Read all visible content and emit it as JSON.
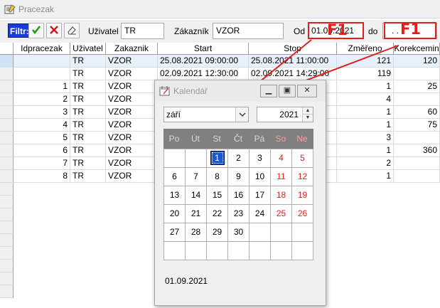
{
  "window": {
    "title": "Pracezak",
    "icon": "notebook-icon"
  },
  "filter": {
    "label": "Filtr:",
    "apply_icon": "checkmark-icon",
    "clear_icon": "x-icon",
    "erase_icon": "eraser-icon",
    "user_label": "Uživatel",
    "user_value": "TR",
    "customer_label": "Zákazník",
    "customer_value": "VZOR",
    "from_label": "Od",
    "from_value": "01.09.2021",
    "to_label": "do",
    "to_value": ". .",
    "annotation_from": "F1",
    "annotation_to": "F1"
  },
  "table": {
    "columns": [
      "Idpracezak",
      "Uživatel",
      "Zakaznik",
      "Start",
      "Stop",
      "Změřeno",
      "Korekcemin"
    ],
    "rows": [
      {
        "id": "",
        "user": "TR",
        "customer": "VZOR",
        "start": "25.08.2021 09:00:00",
        "stop": "25.08.2021 11:00:00",
        "measured": "121",
        "correction": "120"
      },
      {
        "id": "",
        "user": "TR",
        "customer": "VZOR",
        "start": "02.09.2021 12:30:00",
        "stop": "02.09.2021 14:29:00",
        "measured": "119",
        "correction": ""
      },
      {
        "id": "1",
        "user": "TR",
        "customer": "VZOR",
        "start": "",
        "stop": "3",
        "measured": "1",
        "correction": "25"
      },
      {
        "id": "2",
        "user": "TR",
        "customer": "VZOR",
        "start": "",
        "stop": "5",
        "measured": "4",
        "correction": ""
      },
      {
        "id": "3",
        "user": "TR",
        "customer": "VZOR",
        "start": "",
        "stop": "2",
        "measured": "1",
        "correction": "60"
      },
      {
        "id": "4",
        "user": "TR",
        "customer": "VZOR",
        "start": "",
        "stop": "1",
        "measured": "1",
        "correction": "75"
      },
      {
        "id": "5",
        "user": "TR",
        "customer": "VZOR",
        "start": "",
        "stop": "9",
        "measured": "3",
        "correction": ""
      },
      {
        "id": "6",
        "user": "TR",
        "customer": "VZOR",
        "start": "",
        "stop": "7",
        "measured": "1",
        "correction": "360"
      },
      {
        "id": "7",
        "user": "TR",
        "customer": "VZOR",
        "start": "",
        "stop": "9",
        "measured": "2",
        "correction": ""
      },
      {
        "id": "8",
        "user": "TR",
        "customer": "VZOR",
        "start": "",
        "stop": "4",
        "measured": "1",
        "correction": ""
      }
    ]
  },
  "calendar": {
    "title": "Kalendář",
    "icon": "calendar-icon",
    "month": "září",
    "year": "2021",
    "weekdays": [
      "Po",
      "Út",
      "St",
      "Čt",
      "Pá",
      "So",
      "Ne"
    ],
    "weeks": [
      [
        "",
        "",
        "1",
        "2",
        "3",
        "4",
        "5"
      ],
      [
        "6",
        "7",
        "8",
        "9",
        "10",
        "11",
        "12"
      ],
      [
        "13",
        "14",
        "15",
        "16",
        "17",
        "18",
        "19"
      ],
      [
        "20",
        "21",
        "22",
        "23",
        "24",
        "25",
        "26"
      ],
      [
        "27",
        "28",
        "29",
        "30",
        "",
        "",
        ""
      ],
      [
        "",
        "",
        "",
        "",
        "",
        "",
        ""
      ]
    ],
    "selected_day": "1",
    "selected_date": "01.09.2021",
    "colors": {
      "weekend": "#e02020",
      "selected": "#1e58c8",
      "header_bg": "#808080"
    }
  },
  "colors": {
    "filter_label_bg": "#1b3bd8",
    "annotation": "#e02020",
    "selected_row": "#e7f1fb"
  }
}
